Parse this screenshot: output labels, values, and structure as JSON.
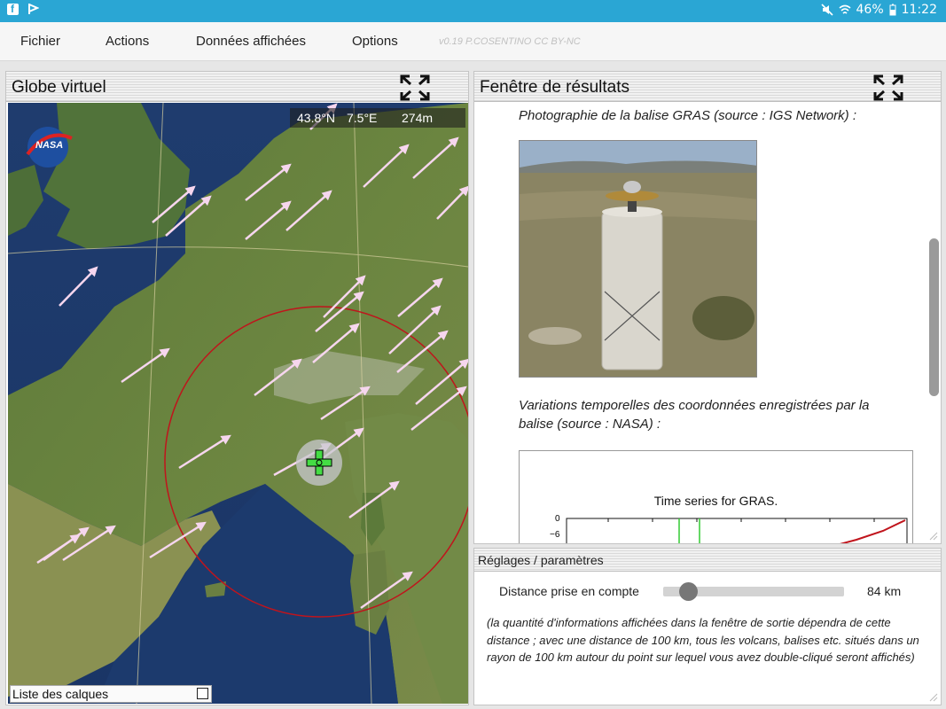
{
  "status_bar": {
    "battery": "46%",
    "time": "11:22",
    "icons": [
      "facebook-icon",
      "flag-icon",
      "mute-icon",
      "wifi-icon",
      "battery-icon"
    ]
  },
  "menu": {
    "items": [
      "Fichier",
      "Actions",
      "Données affichées",
      "Options"
    ],
    "version": "v0.19 P.COSENTINO CC BY-NC"
  },
  "globe": {
    "title": "Globe virtuel",
    "lat": "43.8°N",
    "lon": "7.5°E",
    "alt": "274m",
    "logo": "NASA",
    "layers_label": "Liste des calques"
  },
  "results": {
    "title": "Fenêtre de résultats",
    "photo_caption": "Photographie de la balise GRAS (source : IGS Network) :",
    "series_caption": "Variations temporelles des coordonnées enregistrées par la balise (source : NASA) :",
    "chart_title": "Time series for GRAS.",
    "chart_y_ticks": [
      "0",
      "−6"
    ]
  },
  "settings": {
    "title": "Réglages / paramètres",
    "distance_label": "Distance prise en compte",
    "distance_value": "84 km",
    "distance_fraction": 0.1,
    "note": "(la quantité d'informations affichées dans la fenêtre de sortie dépendra de cette distance ; avec une distance de 100 km, tous les volcans, balises etc. situés dans un rayon de 100 km autour du point sur lequel vous avez double-cliqué seront affichés)"
  },
  "colors": {
    "status_bar": "#2aa6d4",
    "arrow": "#f6d6ee",
    "circle": "#c0141c",
    "crosshair": "#33cc33"
  }
}
